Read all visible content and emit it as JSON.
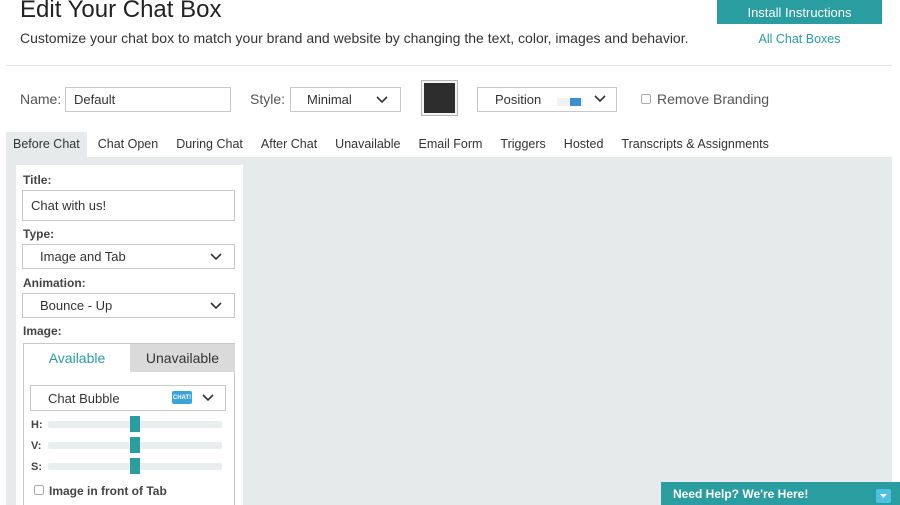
{
  "header": {
    "title": "Edit Your Chat Box",
    "subtitle": "Customize your chat box to match your brand and website by changing the text, color, images and behavior.",
    "install_button": "Install Instructions",
    "all_boxes_link": "All Chat Boxes"
  },
  "settings": {
    "name_label": "Name:",
    "name_value": "Default",
    "style_label": "Style:",
    "style_value": "Minimal",
    "color": "#2d2d2d",
    "position_label": "Position",
    "remove_branding_label": "Remove Branding",
    "remove_branding_checked": false
  },
  "tabs": [
    {
      "label": "Before Chat",
      "active": true
    },
    {
      "label": "Chat Open"
    },
    {
      "label": "During Chat"
    },
    {
      "label": "After Chat"
    },
    {
      "label": "Unavailable"
    },
    {
      "label": "Email Form"
    },
    {
      "label": "Triggers"
    },
    {
      "label": "Hosted"
    },
    {
      "label": "Transcripts & Assignments"
    }
  ],
  "form": {
    "title_label": "Title:",
    "title_value": "Chat with us!",
    "type_label": "Type:",
    "type_value": "Image and Tab",
    "animation_label": "Animation:",
    "animation_value": "Bounce - Up",
    "image_label": "Image:",
    "image_tabs": {
      "available": "Available",
      "unavailable": "Unavailable"
    },
    "image_select": "Chat Bubble",
    "image_badge": "CHAT!",
    "sliders": {
      "h_label": "H:",
      "v_label": "V:",
      "s_label": "S:",
      "h_value": 0.5,
      "v_value": 0.5,
      "s_value": 0.5
    },
    "image_front_label": "Image in front of Tab",
    "image_front_checked": false
  },
  "help_widget": {
    "label": "Need Help? We're Here!"
  },
  "colors": {
    "accent": "#2a9da0",
    "content_bg": "#e6eaea",
    "badge": "#3aa4d8"
  }
}
